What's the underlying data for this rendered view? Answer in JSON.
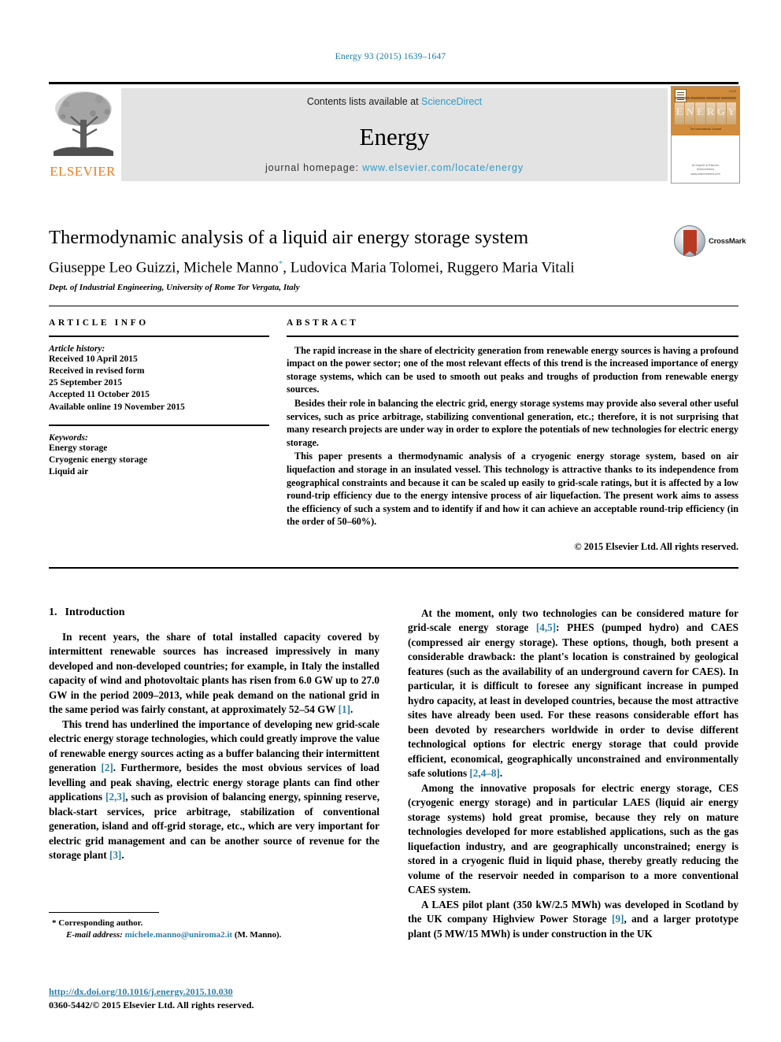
{
  "running_head": "Energy 93 (2015) 1639–1647",
  "masthead": {
    "publisher": "ELSEVIER",
    "contents_prefix": "Contents lists available at ",
    "contents_link": "ScienceDirect",
    "journal_name": "Energy",
    "homepage_prefix": "journal homepage: ",
    "homepage_url": "www.elsevier.com/locate/energy",
    "cover": {
      "title": "ENERGY",
      "issue_label": "Vol 93",
      "caption": "The International Journal",
      "footer_line1": "An Imprint of Elsevier",
      "footer_line2": "ScienceDirect",
      "footer_line3": "www.sciencedirect.com"
    }
  },
  "article": {
    "title": "Thermodynamic analysis of a liquid air energy storage system",
    "authors": "Giuseppe Leo Guizzi, Michele Manno",
    "author_marker": "*",
    "authors_rest": ", Ludovica Maria Tolomei, Ruggero Maria Vitali",
    "affiliation": "Dept. of Industrial Engineering, University of Rome Tor Vergata, Italy",
    "crossmark_label": "CrossMark"
  },
  "article_info": {
    "heading": "ARTICLE INFO",
    "history_label": "Article history:",
    "history": [
      "Received 10 April 2015",
      "Received in revised form",
      "25 September 2015",
      "Accepted 11 October 2015",
      "Available online 19 November 2015"
    ],
    "keywords_label": "Keywords:",
    "keywords": [
      "Energy storage",
      "Cryogenic energy storage",
      "Liquid air"
    ]
  },
  "abstract": {
    "heading": "ABSTRACT",
    "paragraphs": [
      "The rapid increase in the share of electricity generation from renewable energy sources is having a profound impact on the power sector; one of the most relevant effects of this trend is the increased importance of energy storage systems, which can be used to smooth out peaks and troughs of production from renewable energy sources.",
      "Besides their role in balancing the electric grid, energy storage systems may provide also several other useful services, such as price arbitrage, stabilizing conventional generation, etc.; therefore, it is not surprising that many research projects are under way in order to explore the potentials of new technologies for electric energy storage.",
      "This paper presents a thermodynamic analysis of a cryogenic energy storage system, based on air liquefaction and storage in an insulated vessel. This technology is attractive thanks to its independence from geographical constraints and because it can be scaled up easily to grid-scale ratings, but it is affected by a low round-trip efficiency due to the energy intensive process of air liquefaction. The present work aims to assess the efficiency of such a system and to identify if and how it can achieve an acceptable round-trip efficiency (in the order of 50–60%)."
    ],
    "copyright": "© 2015 Elsevier Ltd. All rights reserved."
  },
  "body": {
    "section_number": "1.",
    "section_title": "Introduction",
    "left_paragraphs": [
      "In recent years, the share of total installed capacity covered by intermittent renewable sources has increased impressively in many developed and non-developed countries; for example, in Italy the installed capacity of wind and photovoltaic plants has risen from 6.0 GW up to 27.0 GW in the period 2009–2013, while peak demand on the national grid in the same period was fairly constant, at approximately 52–54 GW [1].",
      "This trend has underlined the importance of developing new grid-scale electric energy storage technologies, which could greatly improve the value of renewable energy sources acting as a buffer balancing their intermittent generation [2]. Furthermore, besides the most obvious services of load levelling and peak shaving, electric energy storage plants can find other applications [2,3], such as provision of balancing energy, spinning reserve, black-start services, price arbitrage, stabilization of conventional generation, island and off-grid storage, etc., which are very important for electric grid management and can be another source of revenue for the storage plant [3]."
    ],
    "right_paragraphs": [
      "At the moment, only two technologies can be considered mature for grid-scale energy storage [4,5]: PHES (pumped hydro) and CAES (compressed air energy storage). These options, though, both present a considerable drawback: the plant's location is constrained by geological features (such as the availability of an underground cavern for CAES). In particular, it is difficult to foresee any significant increase in pumped hydro capacity, at least in developed countries, because the most attractive sites have already been used. For these reasons considerable effort has been devoted by researchers worldwide in order to devise different technological options for electric energy storage that could provide efficient, economical, geographically unconstrained and environmentally safe solutions [2,4–8].",
      "Among the innovative proposals for electric energy storage, CES (cryogenic energy storage) and in particular LAES (liquid air energy storage systems) hold great promise, because they rely on mature technologies developed for more established applications, such as the gas liquefaction industry, and are geographically unconstrained; energy is stored in a cryogenic fluid in liquid phase, thereby greatly reducing the volume of the reservoir needed in comparison to a more conventional CAES system.",
      "A LAES pilot plant (350 kW/2.5 MWh) was developed in Scotland by the UK company Highview Power Storage [9], and a larger prototype plant (5 MW/15 MWh) is under construction in the UK"
    ]
  },
  "footnote": {
    "corresponding": "* Corresponding author.",
    "email_label": "E-mail address:",
    "email": "michele.manno@uniroma2.it",
    "email_suffix": "(M. Manno)."
  },
  "doi_block": {
    "doi": "http://dx.doi.org/10.1016/j.energy.2015.10.030",
    "issn": "0360-5442/© 2015 Elsevier Ltd. All rights reserved."
  },
  "colors": {
    "link": "#2e9bc9",
    "ref": "#2e7fa8",
    "elsevier_orange": "#ef7d1a",
    "banner_bg": "#e3e3e3",
    "crossmark_red": "#b93a22"
  }
}
